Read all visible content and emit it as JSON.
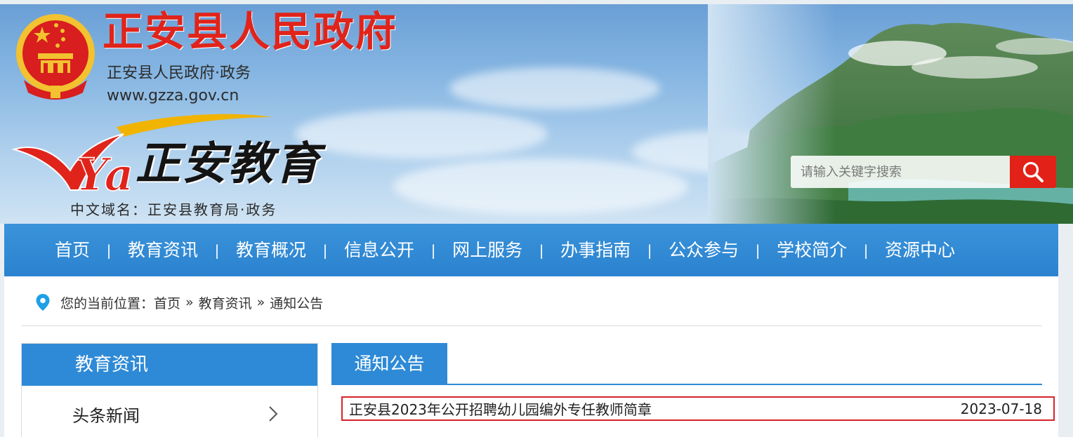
{
  "header": {
    "gov_title": "正安县人民政府",
    "gov_subtitle": "正安县人民政府·政务",
    "gov_url": "www.gzza.gov.cn",
    "edu_title": "正安教育",
    "edu_domain": "中文域名：正安县教育局·政务",
    "logo_mark": "Ya"
  },
  "search": {
    "placeholder": "请输入关键字搜索",
    "value": ""
  },
  "nav": {
    "items": [
      {
        "label": "首页"
      },
      {
        "label": "教育资讯"
      },
      {
        "label": "教育概况"
      },
      {
        "label": "信息公开"
      },
      {
        "label": "网上服务"
      },
      {
        "label": "办事指南"
      },
      {
        "label": "公众参与"
      },
      {
        "label": "学校简介"
      },
      {
        "label": "资源中心"
      }
    ],
    "separator": "|"
  },
  "breadcrumb": {
    "prefix": "您的当前位置：",
    "items": [
      {
        "label": "首页"
      },
      {
        "label": "教育资讯"
      },
      {
        "label": "通知公告"
      }
    ],
    "separator": "»"
  },
  "sidebar": {
    "title": "教育资讯",
    "items": [
      {
        "label": "头条新闻"
      }
    ]
  },
  "main": {
    "tab_label": "通知公告",
    "list": [
      {
        "title": "正安县2023年公开招聘幼儿园编外专任教师简章",
        "date": "2023-07-18",
        "highlighted": true
      }
    ]
  },
  "colors": {
    "brand_red": "#e0241b",
    "nav_blue": "#2e8ad6",
    "highlight_border": "#d8232a"
  },
  "icons": {
    "search": "search-icon",
    "location": "location-pin-icon",
    "chevron": "chevron-right-icon",
    "emblem": "national-emblem-icon"
  }
}
